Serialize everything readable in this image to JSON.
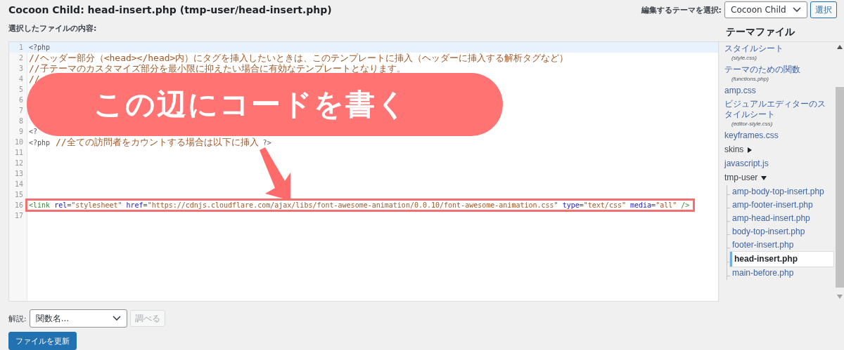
{
  "page_title": "Cocoon Child: head-insert.php (tmp-user/head-insert.php)",
  "theme_picker": {
    "label": "編集するテーマを選択:",
    "value": "Cocoon Child",
    "button": "選択"
  },
  "content_label": "選択したファイルの内容:",
  "editor": {
    "lines": [
      {
        "number": "1",
        "active": true,
        "boxed": false,
        "segments": [
          {
            "kind": "php",
            "text": "<?php"
          }
        ]
      },
      {
        "number": "2",
        "active": false,
        "boxed": false,
        "segments": [
          {
            "kind": "comment",
            "text": "//ヘッダー部分（<head></head>内）にタグを挿入したいときは、このテンプレートに挿入（ヘッダーに挿入する解析タグなど）"
          }
        ]
      },
      {
        "number": "3",
        "active": false,
        "boxed": false,
        "segments": [
          {
            "kind": "comment",
            "text": "//子テーマのカスタマイズ部分を最小限に抑えたい場合に有効なテンプレートとなります。"
          }
        ]
      },
      {
        "number": "4",
        "active": false,
        "boxed": false,
        "segments": [
          {
            "kind": "comment",
            "text": "//"
          }
        ]
      },
      {
        "number": "5",
        "active": false,
        "boxed": false
      },
      {
        "number": "6",
        "active": false,
        "boxed": false
      },
      {
        "number": "7",
        "active": false,
        "boxed": false
      },
      {
        "number": "8",
        "active": false,
        "boxed": false
      },
      {
        "number": "9",
        "active": false,
        "boxed": false,
        "segments": [
          {
            "kind": "php",
            "text": "<?"
          }
        ]
      },
      {
        "number": "10",
        "active": false,
        "boxed": false,
        "segments": [
          {
            "kind": "php",
            "text": "<?php"
          },
          {
            "kind": "comment",
            "text": " //全ての訪問者をカウントする場合は以下に挿入"
          },
          {
            "kind": "php",
            "text": " ?>"
          }
        ]
      },
      {
        "number": "11",
        "active": false,
        "boxed": false
      },
      {
        "number": "12",
        "active": false,
        "boxed": false
      },
      {
        "number": "13",
        "active": false,
        "boxed": false
      },
      {
        "number": "14",
        "active": false,
        "boxed": false
      },
      {
        "number": "15",
        "active": false,
        "boxed": false
      },
      {
        "number": "16",
        "active": false,
        "boxed": true,
        "segments": [
          {
            "kind": "tag",
            "text": "<link"
          },
          {
            "kind": "attr",
            "text": " rel"
          },
          {
            "kind": "plain",
            "text": "="
          },
          {
            "kind": "string",
            "text": "\"stylesheet\""
          },
          {
            "kind": "attr",
            "text": " href"
          },
          {
            "kind": "plain",
            "text": "="
          },
          {
            "kind": "string",
            "text": "\"https://cdnjs.cloudflare.com/ajax/libs/font-awesome-animation/0.0.10/font-awesome-animation.css\""
          },
          {
            "kind": "attr",
            "text": " type"
          },
          {
            "kind": "plain",
            "text": "="
          },
          {
            "kind": "string",
            "text": "\"text/css\""
          },
          {
            "kind": "attr",
            "text": " media"
          },
          {
            "kind": "plain",
            "text": "="
          },
          {
            "kind": "string",
            "text": "\"all\""
          },
          {
            "kind": "tag",
            "text": " />"
          }
        ]
      },
      {
        "number": "17",
        "active": false,
        "boxed": false
      }
    ],
    "callout": "この辺にコードを書く"
  },
  "sidebar": {
    "title": "テーマファイル",
    "items": [
      {
        "kind": "file",
        "label": "スタイルシート",
        "subtitle": "(style.css)",
        "selected": false
      },
      {
        "kind": "file",
        "label": "テーマのための関数",
        "subtitle": "(functions.php)",
        "selected": false
      },
      {
        "kind": "file",
        "label": "amp.css",
        "selected": false
      },
      {
        "kind": "file",
        "label": "ビジュアルエディターのスタイルシート",
        "subtitle": "(editor-style.css)",
        "selected": false
      },
      {
        "kind": "file",
        "label": "keyframes.css",
        "selected": false
      },
      {
        "kind": "folder",
        "label": "skins",
        "expanded": false
      },
      {
        "kind": "file",
        "label": "javascript.js",
        "selected": false
      },
      {
        "kind": "folder",
        "label": "tmp-user",
        "expanded": true,
        "children": [
          {
            "kind": "file",
            "label": "amp-body-top-insert.php",
            "selected": false
          },
          {
            "kind": "file",
            "label": "amp-footer-insert.php",
            "selected": false
          },
          {
            "kind": "file",
            "label": "amp-head-insert.php",
            "selected": false
          },
          {
            "kind": "file",
            "label": "body-top-insert.php",
            "selected": false
          },
          {
            "kind": "file",
            "label": "footer-insert.php",
            "selected": false
          },
          {
            "kind": "file",
            "label": "head-insert.php",
            "selected": true
          },
          {
            "kind": "file",
            "label": "main-before.php",
            "selected": false
          }
        ]
      }
    ]
  },
  "docs": {
    "label": "解説:",
    "placeholder": "関数名...",
    "button": "調べる",
    "button_disabled": true
  },
  "update_button": "ファイルを更新"
}
